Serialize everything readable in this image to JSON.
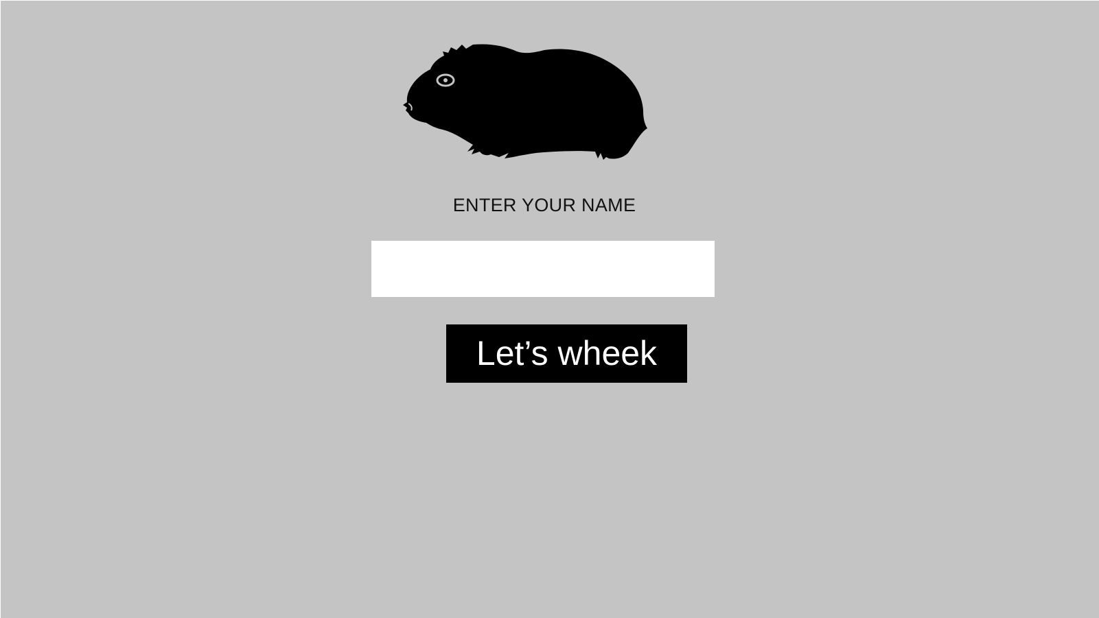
{
  "logo": {
    "icon": "guinea-pig-icon",
    "color": "#000000"
  },
  "prompt": {
    "label": "ENTER YOUR NAME"
  },
  "name_input": {
    "value": "",
    "placeholder": ""
  },
  "submit_button": {
    "label": "Let’s wheek"
  },
  "colors": {
    "background": "#c4c4c4",
    "input_background": "#ffffff",
    "button_background": "#000000",
    "button_text": "#ffffff"
  }
}
